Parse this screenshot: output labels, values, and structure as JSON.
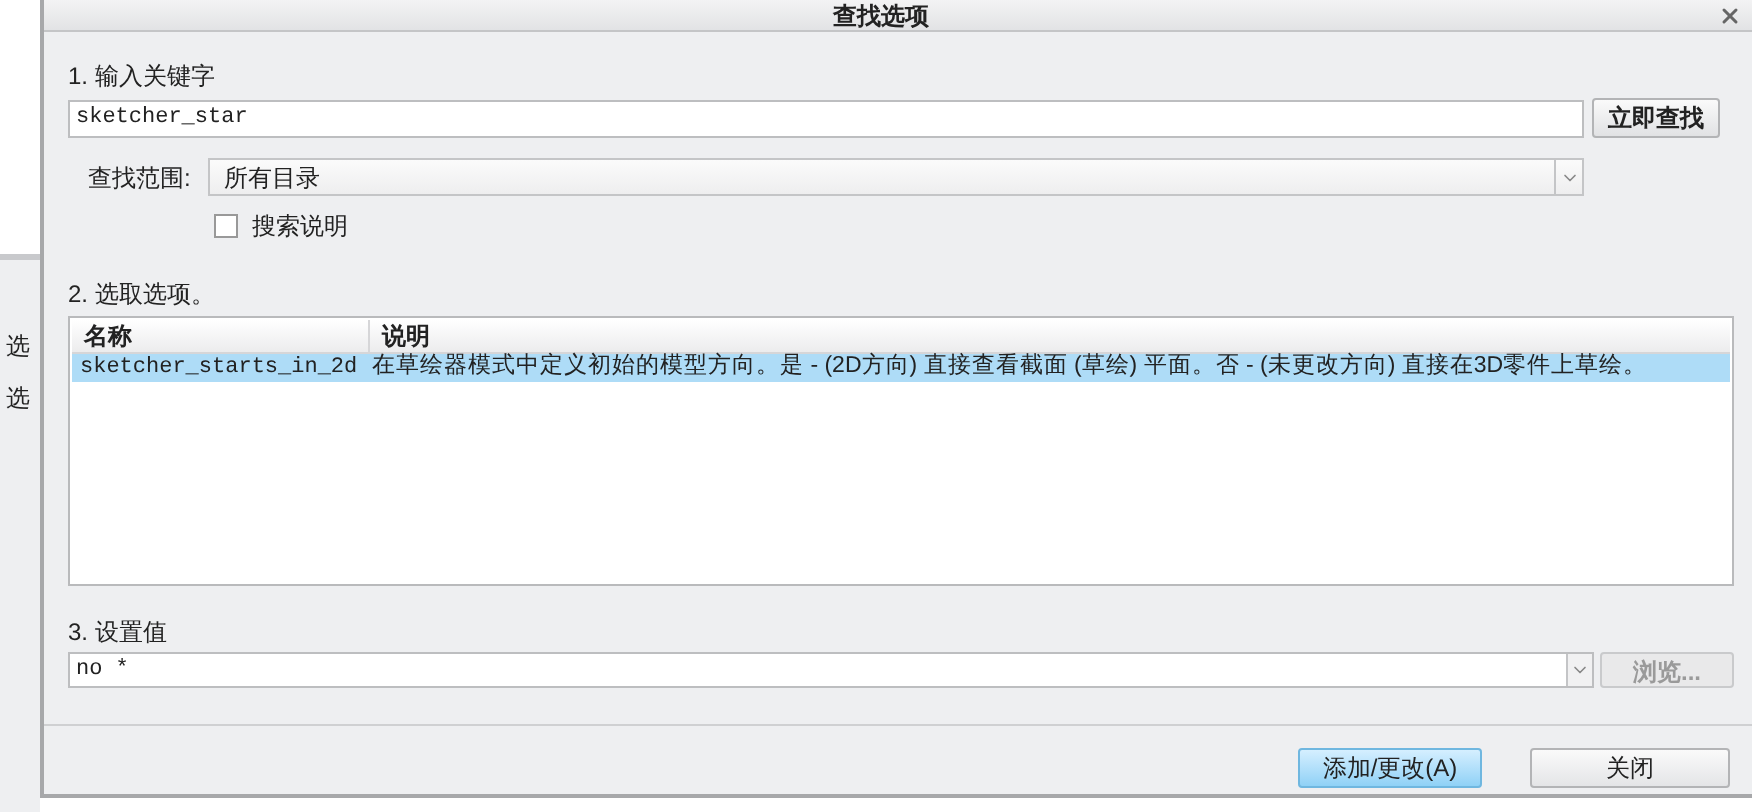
{
  "background": {
    "labels": [
      "选",
      "选"
    ]
  },
  "window": {
    "title": "查找选项"
  },
  "step1": {
    "label": "1.  输入关键字",
    "value": "sketcher_star",
    "search_button": "立即查找",
    "scope_label": "查找范围:",
    "scope_value": "所有目录",
    "search_desc": {
      "label": "搜索说明",
      "checked": false
    }
  },
  "step2": {
    "label": "2.  选取选项。",
    "columns": [
      "名称",
      "说明"
    ],
    "rows": [
      {
        "name": "sketcher_starts_in_2d",
        "description": "在草绘器模式中定义初始的模型方向。是 - (2D方向) 直接查看截面 (草绘) 平面。否 - (未更改方向) 直接在3D零件上草绘。",
        "selected": true
      }
    ]
  },
  "step3": {
    "label": "3.  设置值",
    "value": "no *",
    "browse_button": {
      "label": "浏览...",
      "disabled": true
    }
  },
  "buttons": [
    {
      "label": "添加/更改(A)",
      "primary": true
    },
    {
      "label": "关闭",
      "primary": false
    }
  ]
}
